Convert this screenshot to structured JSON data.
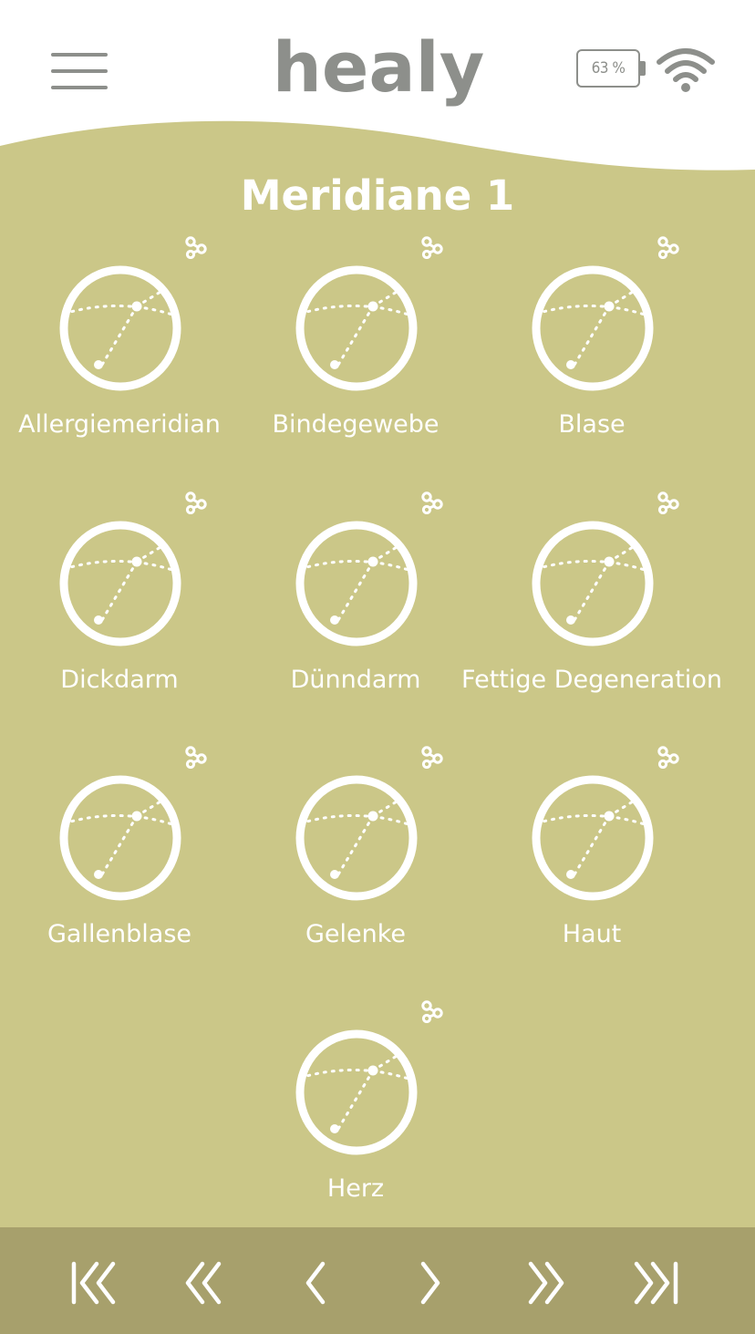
{
  "header": {
    "logo_text": "healy",
    "battery_label": "63 %",
    "menu_icon": "hamburger-menu-icon",
    "wifi_icon": "wifi-icon"
  },
  "page": {
    "title": "Meridiane 1"
  },
  "programs": [
    {
      "label": "Allergiemeridian"
    },
    {
      "label": "Bindegewebe"
    },
    {
      "label": "Blase"
    },
    {
      "label": "Dickdarm"
    },
    {
      "label": "Dünndarm"
    },
    {
      "label": "Fettige Degeneration"
    },
    {
      "label": "Gallenblase"
    },
    {
      "label": "Gelenke"
    },
    {
      "label": "Haut"
    },
    {
      "label": "Herz"
    }
  ],
  "footer": {
    "buttons": [
      "first-page",
      "previous-fast",
      "previous",
      "next",
      "next-fast",
      "last-page"
    ]
  },
  "colors": {
    "background": "#cbc788",
    "header": "#ffffff",
    "footer": "#a7a06c",
    "foreground": "#ffffff",
    "icon_gray": "#8d8f8b"
  }
}
